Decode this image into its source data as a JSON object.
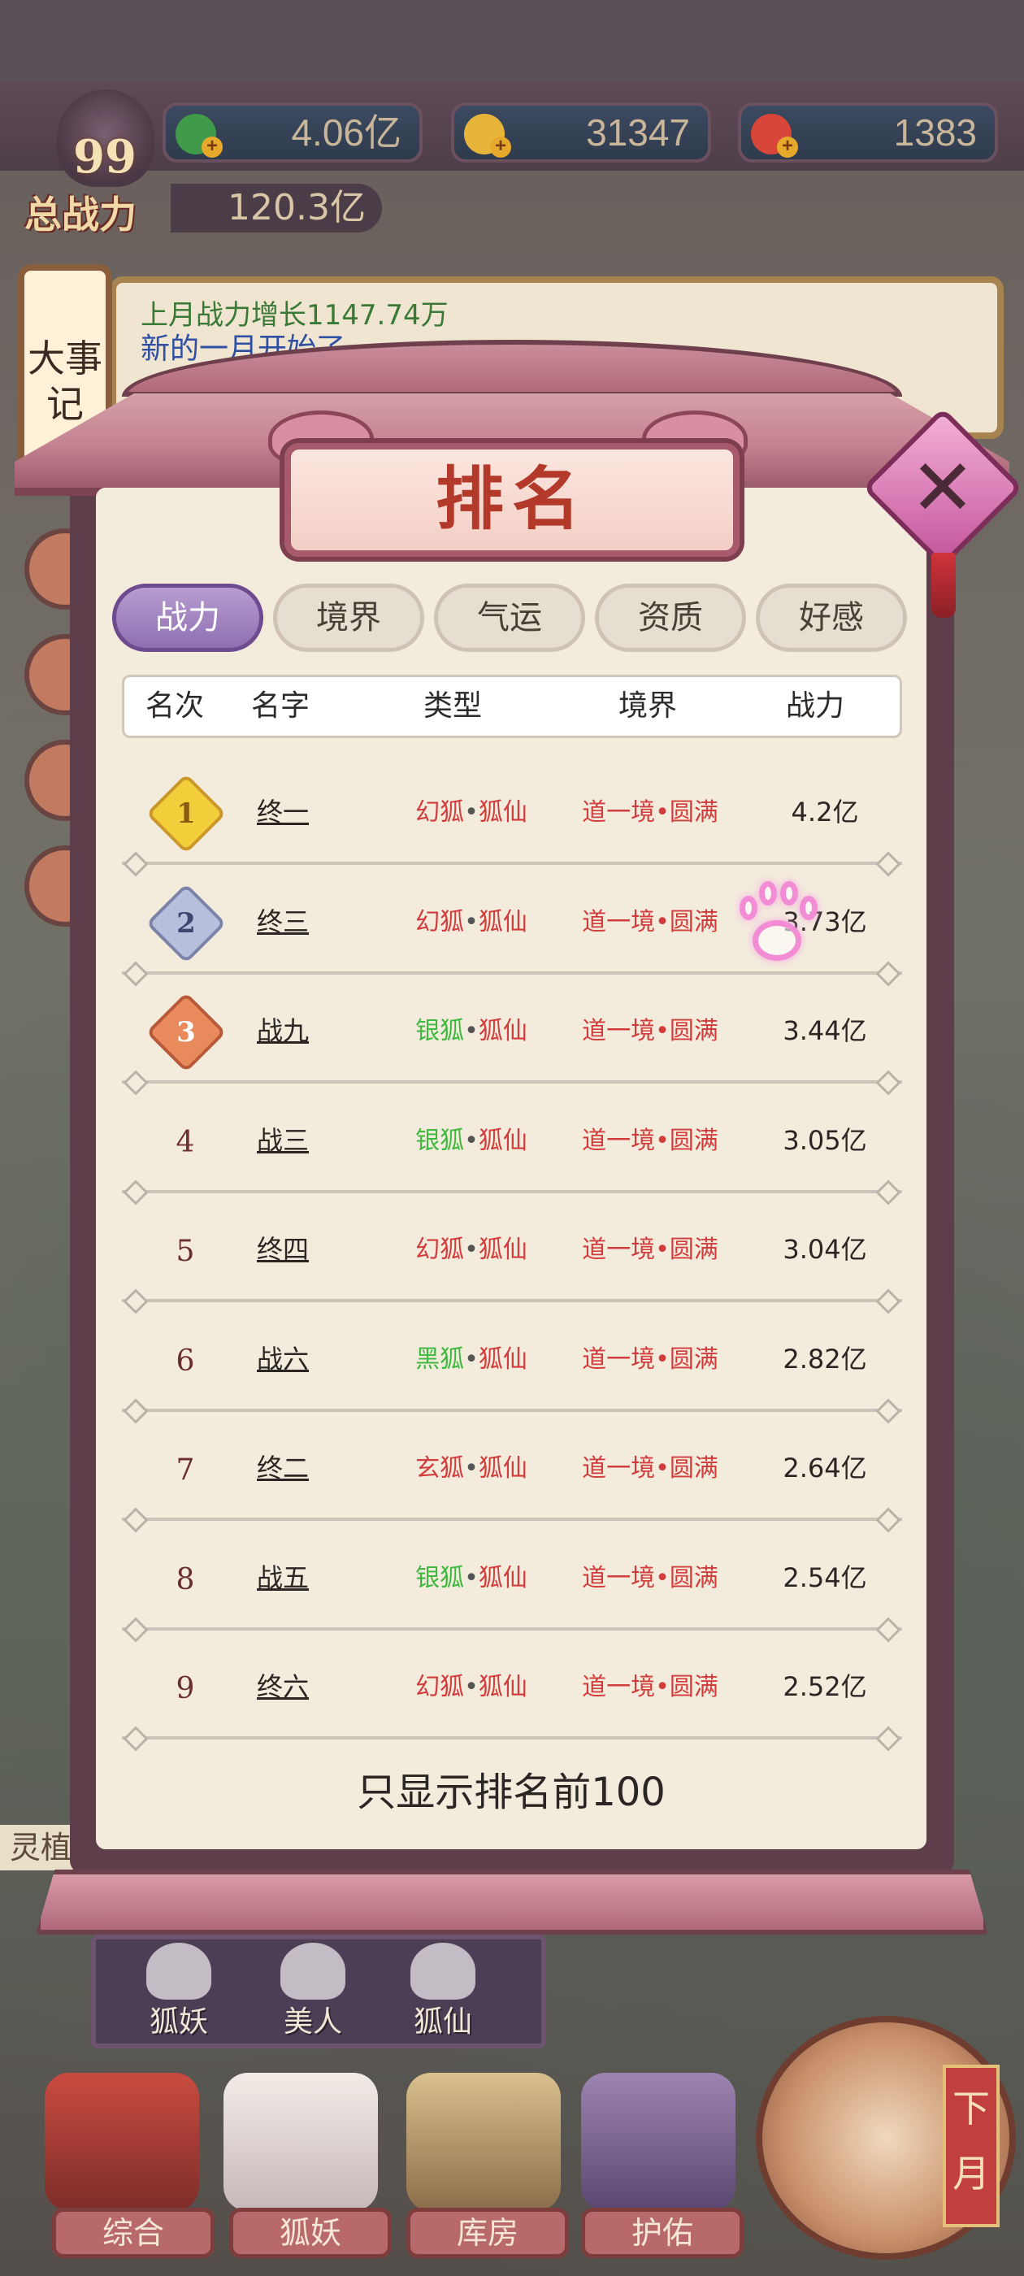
{
  "resources": {
    "jade": "4.06亿",
    "gold": "31347",
    "peach": "1383"
  },
  "power": {
    "level": "99",
    "label": "总战力",
    "value": "120.3亿"
  },
  "background_panel": {
    "side_label": "大事记",
    "line1": "上月战力增长1147.74万",
    "line2": "新的一月开始了"
  },
  "left_label": "灵植",
  "modal": {
    "title": "排名",
    "tabs": [
      "战力",
      "境界",
      "气运",
      "资质",
      "好感"
    ],
    "active_tab": "战力",
    "columns": [
      "名次",
      "名字",
      "类型",
      "境界",
      "战力"
    ],
    "rows": [
      {
        "rank": "1",
        "name": "终一",
        "type_prefix": "幻狐",
        "type_suffix": "狐仙",
        "realm": "道一境•圆满",
        "power": "4.2亿",
        "type_color": "#d23c3c"
      },
      {
        "rank": "2",
        "name": "终三",
        "type_prefix": "幻狐",
        "type_suffix": "狐仙",
        "realm": "道一境•圆满",
        "power": "3.73亿",
        "type_color": "#d23c3c"
      },
      {
        "rank": "3",
        "name": "战九",
        "type_prefix": "银狐",
        "type_suffix": "狐仙",
        "realm": "道一境•圆满",
        "power": "3.44亿",
        "type_color": "#3fb83f"
      },
      {
        "rank": "4",
        "name": "战三",
        "type_prefix": "银狐",
        "type_suffix": "狐仙",
        "realm": "道一境•圆满",
        "power": "3.05亿",
        "type_color": "#3fb83f"
      },
      {
        "rank": "5",
        "name": "终四",
        "type_prefix": "幻狐",
        "type_suffix": "狐仙",
        "realm": "道一境•圆满",
        "power": "3.04亿",
        "type_color": "#d23c3c"
      },
      {
        "rank": "6",
        "name": "战六",
        "type_prefix": "黑狐",
        "type_suffix": "狐仙",
        "realm": "道一境•圆满",
        "power": "2.82亿",
        "type_color": "#3fb83f"
      },
      {
        "rank": "7",
        "name": "终二",
        "type_prefix": "玄狐",
        "type_suffix": "狐仙",
        "realm": "道一境•圆满",
        "power": "2.64亿",
        "type_color": "#d23c3c"
      },
      {
        "rank": "8",
        "name": "战五",
        "type_prefix": "银狐",
        "type_suffix": "狐仙",
        "realm": "道一境•圆满",
        "power": "2.54亿",
        "type_color": "#3fb83f"
      },
      {
        "rank": "9",
        "name": "终六",
        "type_prefix": "幻狐",
        "type_suffix": "狐仙",
        "realm": "道一境•圆满",
        "power": "2.52亿",
        "type_color": "#d23c3c"
      }
    ],
    "footer": "只显示排名前100"
  },
  "sub_tabs": [
    "狐妖",
    "美人",
    "狐仙"
  ],
  "nav": [
    "综合",
    "狐妖",
    "库房",
    "护佑"
  ],
  "next_month": "下月",
  "colors": {
    "gold_medal": "#f2cf3a",
    "silver_medal": "#b8bfdc",
    "bronze_medal": "#e88a5c",
    "realm_red": "#d23c3c",
    "active_tab": "#8f6fb2"
  }
}
